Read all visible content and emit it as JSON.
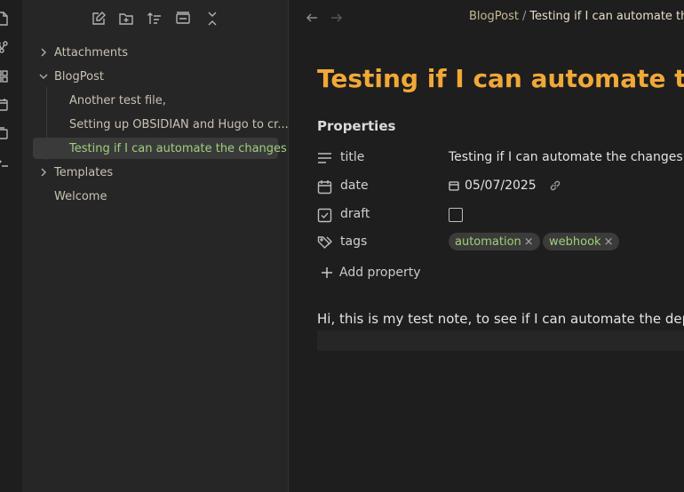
{
  "sidebar": {
    "toolbar": {
      "new_note": "new-note-icon",
      "new_folder": "new-folder-icon",
      "sort": "sort-icon",
      "auto_reveal": "auto-reveal-icon",
      "collapse": "collapse-all-icon"
    },
    "tree": {
      "attachments": "Attachments",
      "blogpost": "BlogPost",
      "file1": "Another test file,",
      "file2": "Setting up OBSIDIAN and Hugo to cr...",
      "file3": "Testing if I can automate the changes",
      "templates": "Templates",
      "welcome": "Welcome"
    }
  },
  "main": {
    "breadcrumb": {
      "parent": "BlogPost",
      "separator": "/",
      "current": "Testing if I can automate the ch"
    },
    "title": "Testing if I can automate the ch",
    "properties": {
      "heading": "Properties",
      "title_key": "title",
      "title_value": "Testing if I can automate the changes",
      "date_key": "date",
      "date_value": "05/07/2025",
      "draft_key": "draft",
      "tags_key": "tags",
      "tag1": "automation",
      "tag2": "webhook",
      "tag_remove": "×",
      "add_label": "Add property"
    },
    "body": "Hi, this is my test note, to see if I can automate the deploym"
  },
  "colors": {
    "title": "#f0a838",
    "active_file": "#9fcf7f",
    "tag_text": "#9fd07a",
    "background": "#1e1e1e",
    "sidebar": "#262626"
  }
}
